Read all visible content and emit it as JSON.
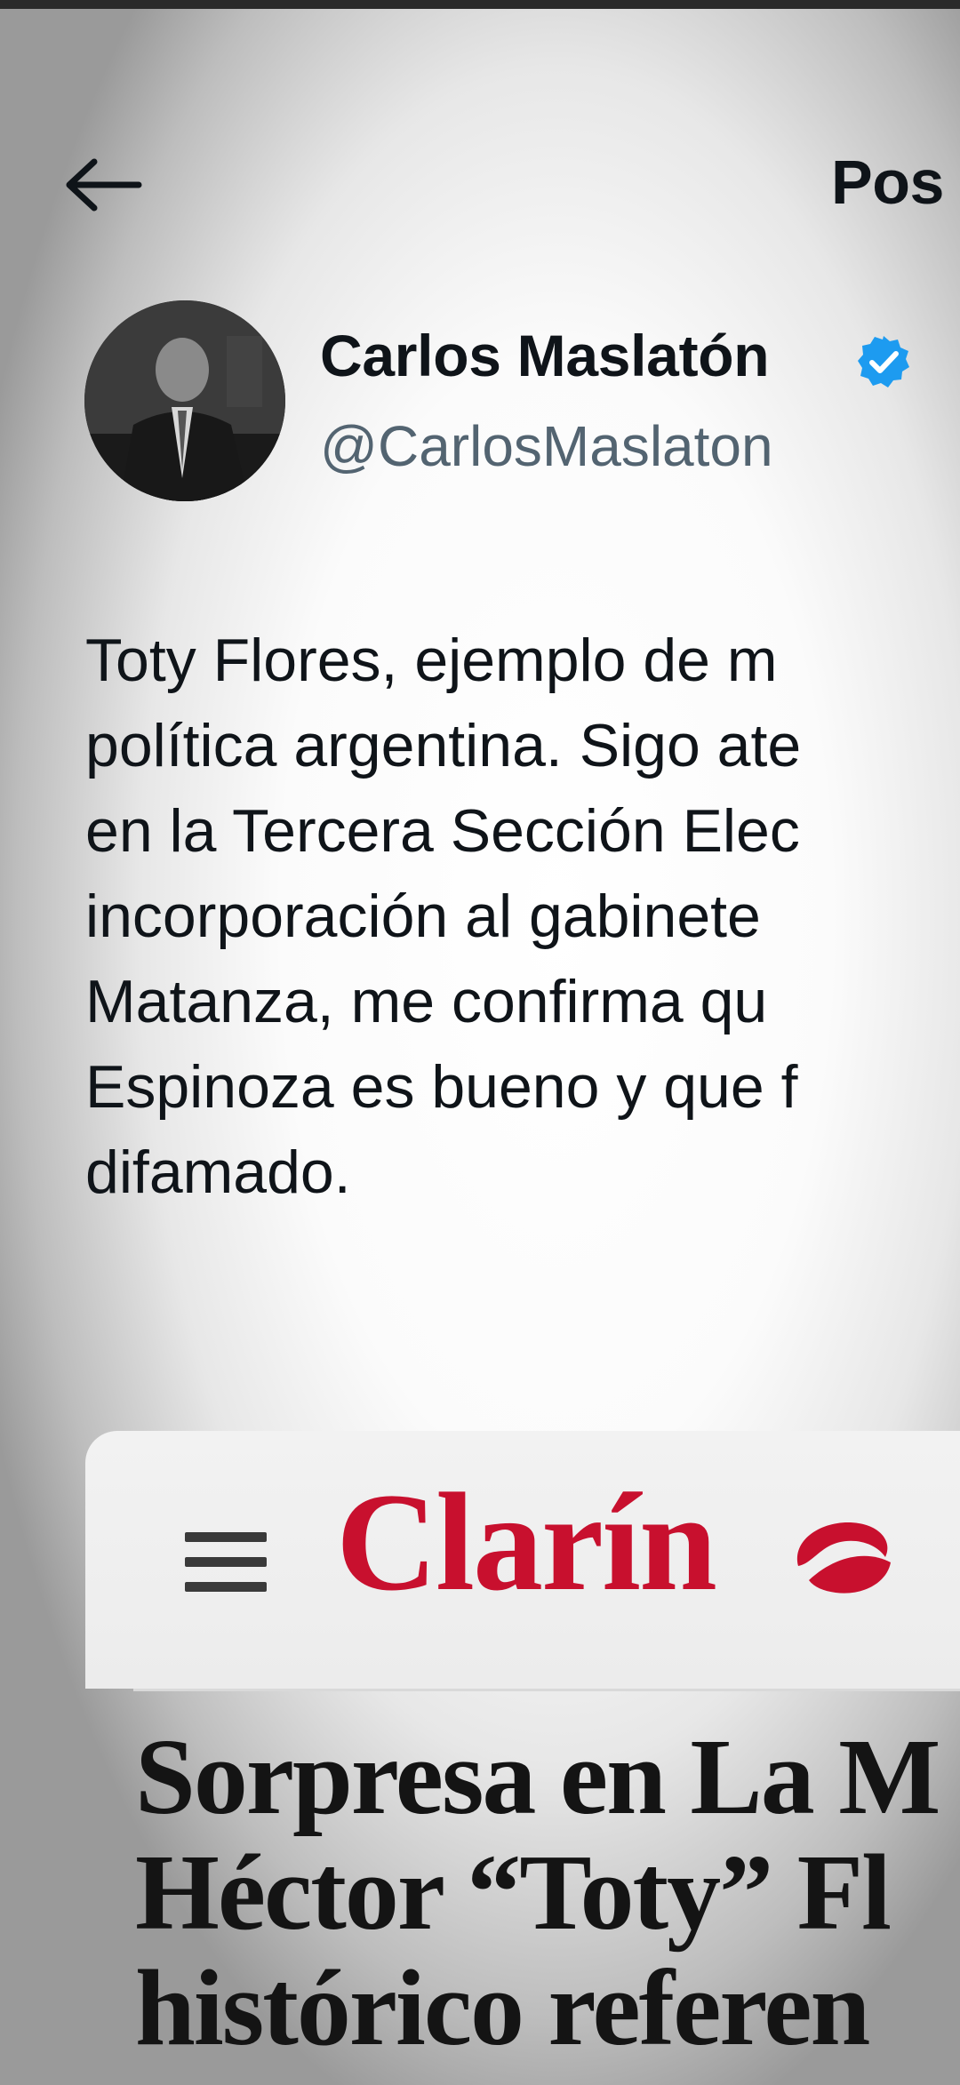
{
  "header": {
    "back_icon": "arrow-left-icon",
    "title": "Pos"
  },
  "author": {
    "display_name": "Carlos Maslatón",
    "handle": "@CarlosMaslaton",
    "verified_icon": "verified-badge-icon",
    "verified_color": "#1d9bf0",
    "avatar": "avatar-photo"
  },
  "post": {
    "lines": [
      "Toty Flores, ejemplo de m",
      "política argentina. Sigo ate",
      "en la Tercera Sección Elec",
      "incorporación al gabinete",
      "Matanza, me confirma qu",
      "Espinoza es bueno y que f",
      "difamado."
    ]
  },
  "link_card": {
    "menu_icon": "hamburger-menu-icon",
    "brand": "Clarín",
    "brand_color": "#c8102e",
    "headline_lines": [
      "Sorpresa en La M",
      "Héctor “Toty” Fl",
      "histórico referen"
    ]
  }
}
